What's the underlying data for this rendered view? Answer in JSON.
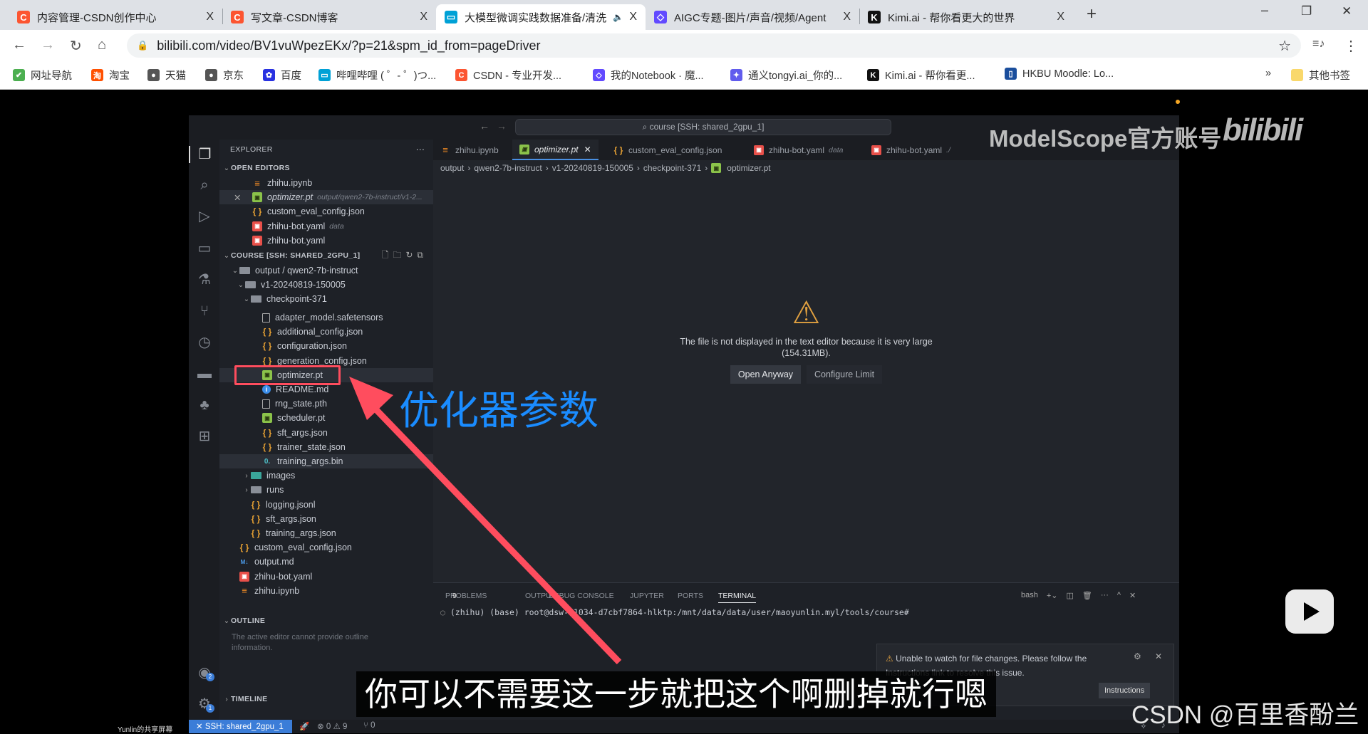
{
  "browser": {
    "tabs": [
      {
        "title": "内容管理-CSDN创作中心",
        "icon": "csdn-icon",
        "color": "#fc5531",
        "glyph": "C"
      },
      {
        "title": "写文章-CSDN博客",
        "icon": "csdn-icon",
        "color": "#fc5531",
        "glyph": "C"
      },
      {
        "title": "大模型微调实践数据准备/清洗",
        "icon": "bilibili-icon",
        "color": "#00a1d6",
        "glyph": "▭",
        "active": true,
        "audio": "🔈"
      },
      {
        "title": "AIGC专题-图片/声音/视频/Agent",
        "icon": "modelscope-icon",
        "color": "#624aff",
        "glyph": "◇"
      },
      {
        "title": "Kimi.ai - 帮你看更大的世界",
        "icon": "kimi-icon",
        "color": "#111111",
        "glyph": "K"
      }
    ],
    "close_glyph": "X",
    "new_tab": "+",
    "window": {
      "minimize": "–",
      "restore": "❐",
      "close": "✕"
    },
    "nav": {
      "back": "←",
      "forward": "→",
      "reload": "↻",
      "home": "⌂"
    },
    "url": "bilibili.com/video/BV1vuWpezEKx/?p=21&spm_id_from=pageDriver",
    "lock": "🔒",
    "star": "☆",
    "media": "≡♪",
    "menu": "⋮",
    "bookmarks": [
      {
        "label": "网址导航",
        "color": "#4caf50",
        "glyph": "✔"
      },
      {
        "label": "淘宝",
        "color": "#ff5000",
        "glyph": "淘"
      },
      {
        "label": "天猫",
        "color": "#555555",
        "glyph": "●"
      },
      {
        "label": "京东",
        "color": "#555555",
        "glyph": "●"
      },
      {
        "label": "百度",
        "color": "#2932e1",
        "glyph": "✿"
      },
      {
        "label": "哔哩哔哩 ( ゜- ゜)つ...",
        "color": "#00a1d6",
        "glyph": "▭"
      },
      {
        "label": "CSDN - 专业开发...",
        "color": "#fc5531",
        "glyph": "C"
      },
      {
        "label": "我的Notebook · 魔...",
        "color": "#624aff",
        "glyph": "◇"
      },
      {
        "label": "通义tongyi.ai_你的...",
        "color": "#615ced",
        "glyph": "✦"
      },
      {
        "label": "Kimi.ai - 帮你看更...",
        "color": "#111111",
        "glyph": "K"
      },
      {
        "label": "HKBU Moodle: Lo...",
        "color": "#1a4e9c",
        "glyph": "▯"
      }
    ],
    "more": "»",
    "other": "其他书签"
  },
  "vscode": {
    "command_center": "⌕ course [SSH: shared_2gpu_1]",
    "nav_back": "←",
    "nav_fwd": "→",
    "explorer_title": "EXPLORER",
    "explorer_more": "···",
    "open_editors": "OPEN EDITORS",
    "open_editor_items": [
      {
        "name": "zhihu.ipynb",
        "type": "ipynb"
      },
      {
        "name": "optimizer.pt",
        "type": "pt",
        "hint": "output/qwen2-7b-instruct/v1-2...",
        "active": true,
        "close": "✕"
      },
      {
        "name": "custom_eval_config.json",
        "type": "json"
      },
      {
        "name": "zhihu-bot.yaml",
        "type": "yaml",
        "hint": "data"
      },
      {
        "name": "zhihu-bot.yaml",
        "type": "yaml"
      }
    ],
    "workspace": "COURSE [SSH: SHARED_2GPU_1]",
    "tree_top": [
      {
        "name": "output / qwen2-7b-instruct",
        "type": "folder",
        "depth": 0,
        "chev": "⌄"
      },
      {
        "name": "v1-20240819-150005",
        "type": "folder",
        "depth": 1,
        "chev": "⌄"
      },
      {
        "name": "checkpoint-371",
        "type": "folder",
        "depth": 2,
        "chev": "⌄"
      }
    ],
    "tree": [
      {
        "name": "adapter_model.safetensors",
        "type": "file",
        "depth": 3
      },
      {
        "name": "additional_config.json",
        "type": "json",
        "depth": 3
      },
      {
        "name": "configuration.json",
        "type": "json",
        "depth": 3
      },
      {
        "name": "generation_config.json",
        "type": "json",
        "depth": 3
      },
      {
        "name": "optimizer.pt",
        "type": "pt",
        "depth": 3,
        "selected": true
      },
      {
        "name": "README.md",
        "type": "info",
        "depth": 3
      },
      {
        "name": "rng_state.pth",
        "type": "file",
        "depth": 3
      },
      {
        "name": "scheduler.pt",
        "type": "pt",
        "depth": 3
      },
      {
        "name": "sft_args.json",
        "type": "json",
        "depth": 3
      },
      {
        "name": "trainer_state.json",
        "type": "json",
        "depth": 3
      },
      {
        "name": "training_args.bin",
        "type": "bin",
        "depth": 3,
        "hover": true
      },
      {
        "name": "images",
        "type": "folder-img",
        "depth": 2,
        "chev": "›"
      },
      {
        "name": "runs",
        "type": "folder",
        "depth": 2,
        "chev": "›"
      },
      {
        "name": "logging.jsonl",
        "type": "json",
        "depth": 2
      },
      {
        "name": "sft_args.json",
        "type": "json",
        "depth": 2
      },
      {
        "name": "training_args.json",
        "type": "json",
        "depth": 2
      },
      {
        "name": "custom_eval_config.json",
        "type": "json",
        "depth": 0
      },
      {
        "name": "output.md",
        "type": "md",
        "depth": 0
      },
      {
        "name": "zhihu-bot.yaml",
        "type": "yaml",
        "depth": 0
      },
      {
        "name": "zhihu.ipynb",
        "type": "ipynb",
        "depth": 0
      }
    ],
    "outline": "OUTLINE",
    "outline_msg": "The active editor cannot provide outline information.",
    "timeline": "TIMELINE",
    "editor_tabs": [
      {
        "name": "zhihu.ipynb",
        "type": "ipynb"
      },
      {
        "name": "optimizer.pt",
        "type": "pt",
        "active": true,
        "close": "✕"
      },
      {
        "name": "custom_eval_config.json",
        "type": "json"
      },
      {
        "name": "zhihu-bot.yaml",
        "type": "yaml",
        "hint": "data"
      },
      {
        "name": "zhihu-bot.yaml",
        "type": "yaml",
        "hint": "./"
      }
    ],
    "breadcrumb": [
      "output",
      "qwen2-7b-instruct",
      "v1-20240819-150005",
      "checkpoint-371",
      "optimizer.pt"
    ],
    "breadcrumb_sep": "›",
    "warning_icon": "⚠",
    "message": "The file is not displayed in the text editor because it is very large",
    "size": "(154.31MB).",
    "open_anyway": "Open Anyway",
    "configure_limit": "Configure Limit",
    "panel_tabs": [
      "PROBLEMS",
      "OUTPUT",
      "DEBUG CONSOLE",
      "JUPYTER",
      "PORTS",
      "TERMINAL"
    ],
    "problems_count": "9",
    "terminal_shell": "bash",
    "terminal_line": "(zhihu) (base) root@dsw-71034-d7cbf7864-hlktp:/mnt/data/data/user/maoyunlin.myl/tools/course#",
    "notification": {
      "text": "Unable to watch for file changes. Please follow the Instructions link to resolve this issue.",
      "button": "Instructions"
    },
    "status": {
      "remote": "SSH: shared_2gpu_1",
      "errors": "0",
      "warnings": "9",
      "ports": "0"
    },
    "accounts_badge": "2",
    "settings_badge": "1"
  },
  "overlay": {
    "annotation": "优化器参数",
    "subtitle": "你可以不需要这一步就把这个啊删掉就行嗯",
    "watermark": "ModelScope官方账号",
    "bilibili_logo": "bilibili",
    "csdn_watermark": "CSDN @百里香酚兰",
    "screen_share": "Yunlin的共享屏幕",
    "accent": "#ff4d5e",
    "annotation_color": "#1a8cff"
  }
}
